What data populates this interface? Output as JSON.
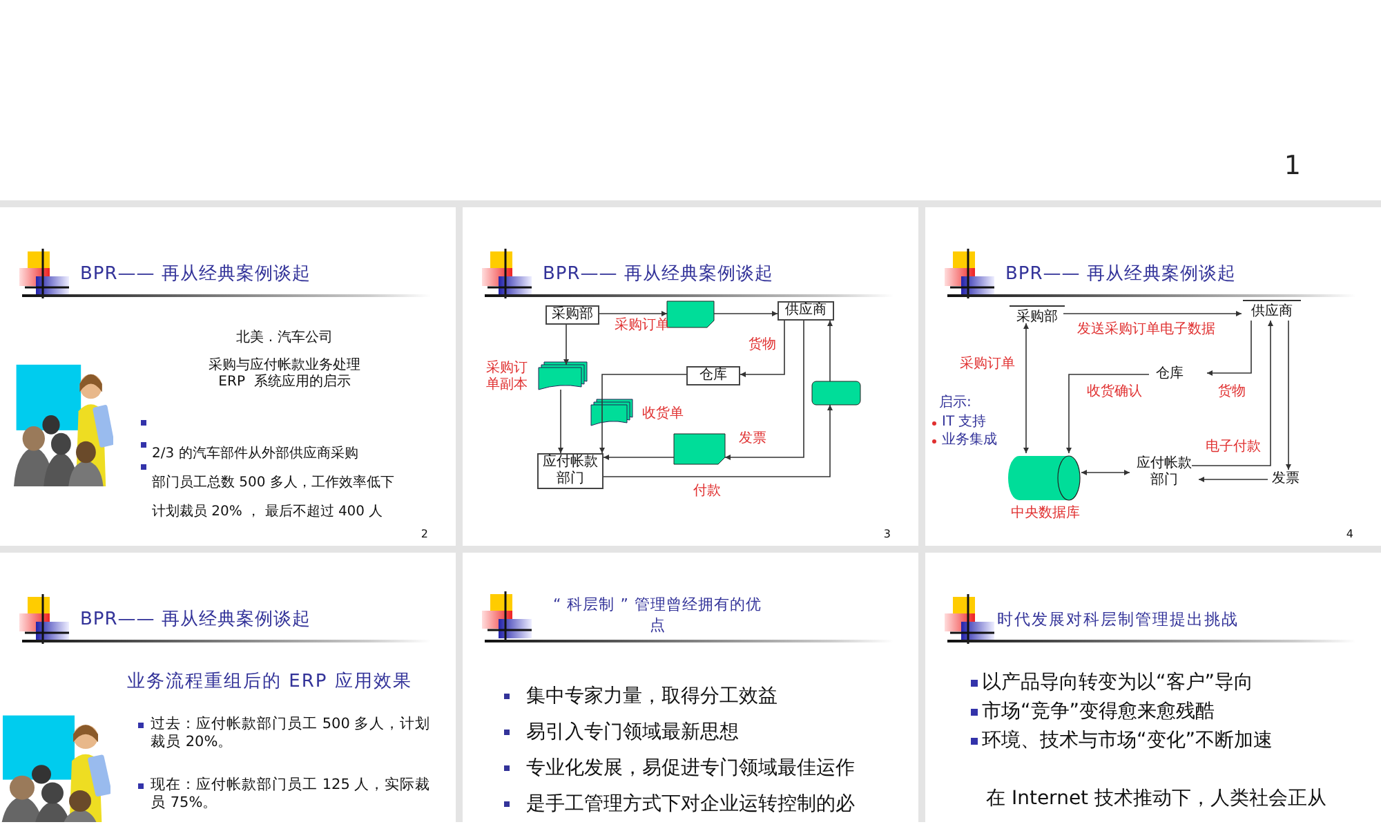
{
  "top_slide": {
    "number": "1"
  },
  "slides": [
    {
      "kind": "intro",
      "number": "2",
      "title": "BPR—— 再从经典案例谈起",
      "heading": [
        "北美 . 汽车公司",
        "采购与应付帐款业务处理",
        "ERP  系统应用的启示"
      ],
      "lines": [
        "2/3 的汽车部件从外部供应商采购",
        "部门员工总数 500 多人，工作效率低下",
        "计划裁员 20% ， 最后不超过 400 人"
      ]
    },
    {
      "kind": "flow",
      "number": "3",
      "title": "BPR—— 再从经典案例谈起",
      "nodes": [
        "采购部",
        "供应商",
        "仓库",
        "应付帐款部门"
      ],
      "labels": [
        "采购订单",
        "货物",
        "采购订单副本",
        "收货单",
        "发票",
        "付款"
      ]
    },
    {
      "kind": "dataflow",
      "number": "4",
      "title": "BPR—— 再从经典案例谈起",
      "nodes": [
        "采购部",
        "供应商",
        "仓库",
        "应付帐款部门",
        "发票"
      ],
      "labels": [
        "发送采购订单电子数据",
        "采购订单",
        "收货确认",
        "货物",
        "电子付款",
        "中央数据库"
      ],
      "note": {
        "heading": "启示:",
        "items": [
          "IT 支持",
          "业务集成"
        ]
      }
    },
    {
      "kind": "results",
      "title": "BPR—— 再从经典案例谈起",
      "subtitle": "业务流程重组后的 ERP 应用效果",
      "bullets": [
        "过去：应付帐款部门员工 500 多人，计划裁员 20%。",
        "现在：应付帐款部门员工 125 人，实际裁员 75%。"
      ]
    },
    {
      "kind": "advantages",
      "title": "“ 科层制 ” 管理曾经拥有的优点",
      "bullets": [
        "集中专家力量，取得分工效益",
        "易引入专门领域最新思想",
        "专业化发展，易促进专门领域最佳运作",
        "是手工管理方式下对企业运转控制的必"
      ]
    },
    {
      "kind": "challenges",
      "title": "时代发展对科层制管理提出挑战",
      "bullets": [
        "以产品导向转变为以“客户”导向",
        "市场“竞争”变得愈来愈残酷",
        "环境、技术与市场“变化”不断加速"
      ],
      "paragraph": "在 Internet 技术推动下，人类社会正从"
    }
  ]
}
